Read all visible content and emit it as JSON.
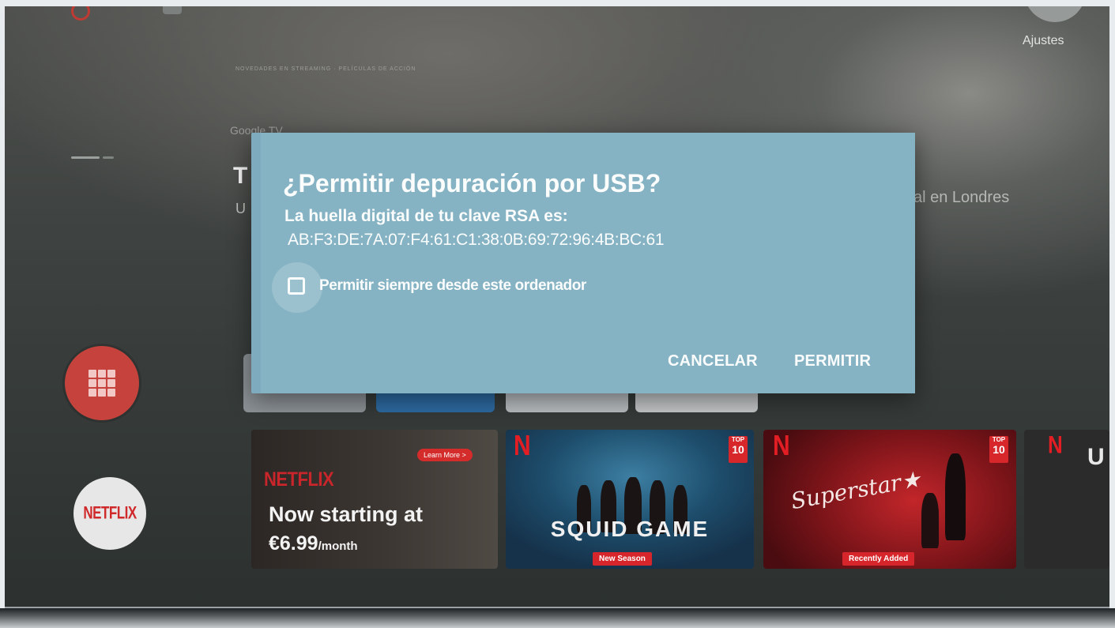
{
  "top_right": {
    "settings_label": "Ajustes"
  },
  "hero": {
    "kicker": "NOVEDADES EN STREAMING · PELÍCULAS DE ACCIÓN",
    "service": "Google TV",
    "title_peek": "T",
    "subtitle_peek": "U",
    "right_caption_peek": "al en Londres"
  },
  "sidebar": {
    "apps_icon": "apps-grid-icon",
    "netflix_label": "NETFLIX"
  },
  "cards": {
    "netflix_promo": {
      "learn_more": "Learn More >",
      "brand": "NETFLIX",
      "headline": "Now starting at",
      "price": "€6.99",
      "period": "/month"
    },
    "squid_game": {
      "n": "N",
      "top_label": "TOP",
      "top_num": "10",
      "title": "SQUID GAME",
      "badge": "New Season"
    },
    "superstar": {
      "n": "N",
      "top_label": "TOP",
      "top_num": "10",
      "title": "Superstar★",
      "badge": "Recently Added"
    },
    "peek": {
      "n": "N",
      "letter": "U"
    }
  },
  "dialog": {
    "title": "¿Permitir depuración por USB?",
    "fingerprint_intro": "La huella digital de tu clave RSA es:",
    "fingerprint": "AB:F3:DE:7A:07:F4:61:C1:38:0B:69:72:96:4B:BC:61",
    "always_allow_label": "Permitir siempre desde este ordenador",
    "always_allow_checked": false,
    "cancel_label": "CANCELAR",
    "allow_label": "PERMITIR"
  },
  "colors": {
    "dialog_bg": "#85b3c4",
    "netflix_red": "#d0292b",
    "apps_button": "#c6433d"
  }
}
